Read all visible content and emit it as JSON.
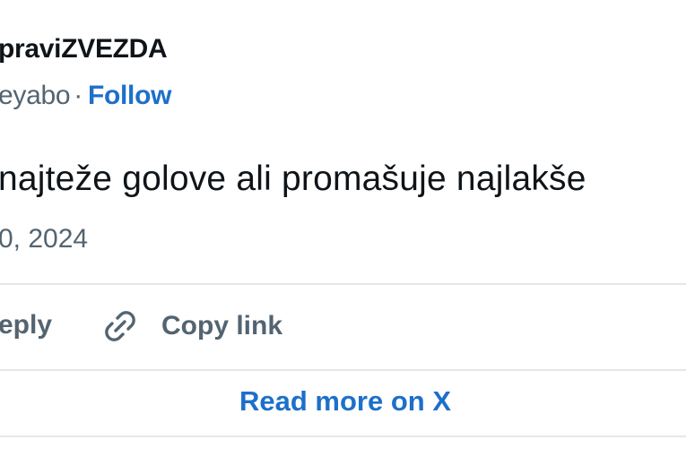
{
  "author": {
    "display_name": "praviZVEZDA",
    "handle": "eyabo",
    "separator": "·",
    "follow_label": "Follow"
  },
  "tweet": {
    "text": "najteže golove ali promašuje najlakše",
    "timestamp": "0, 2024"
  },
  "actions": {
    "reply_label": "eply",
    "copy_link_label": "Copy link",
    "copy_link_icon": "link-icon"
  },
  "footer": {
    "read_more_label": "Read more on X"
  },
  "colors": {
    "link_blue": "#1d70c9",
    "secondary_text": "#536471",
    "primary_text": "#0f1419",
    "divider": "#e3e7ea"
  }
}
